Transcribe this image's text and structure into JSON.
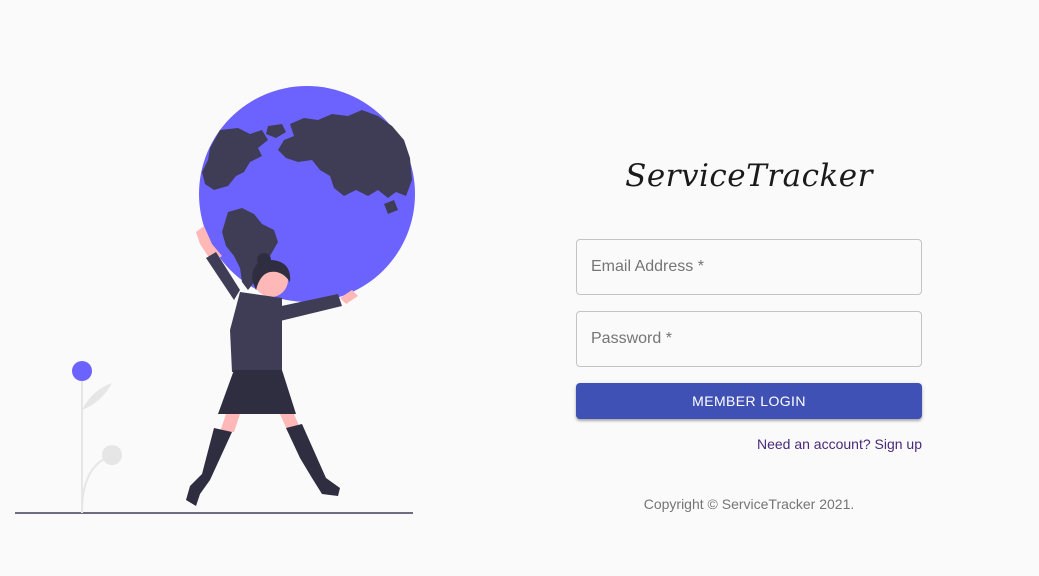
{
  "brand": {
    "name": "ServiceTracker"
  },
  "login_form": {
    "email_placeholder": "Email Address *",
    "email_value": "",
    "password_placeholder": "Password *",
    "password_value": "",
    "submit_label": "MEMBER LOGIN",
    "signup_link": "Need an account? Sign up"
  },
  "footer": {
    "copyright": "Copyright © ServiceTracker 2021."
  },
  "colors": {
    "background": "#fafafa",
    "primary_button": "#3f51b5",
    "globe": "#6c63ff",
    "continents": "#3f3d56",
    "link": "#4a2a78"
  },
  "illustration": {
    "icon": "person-holding-globe-illustration"
  }
}
